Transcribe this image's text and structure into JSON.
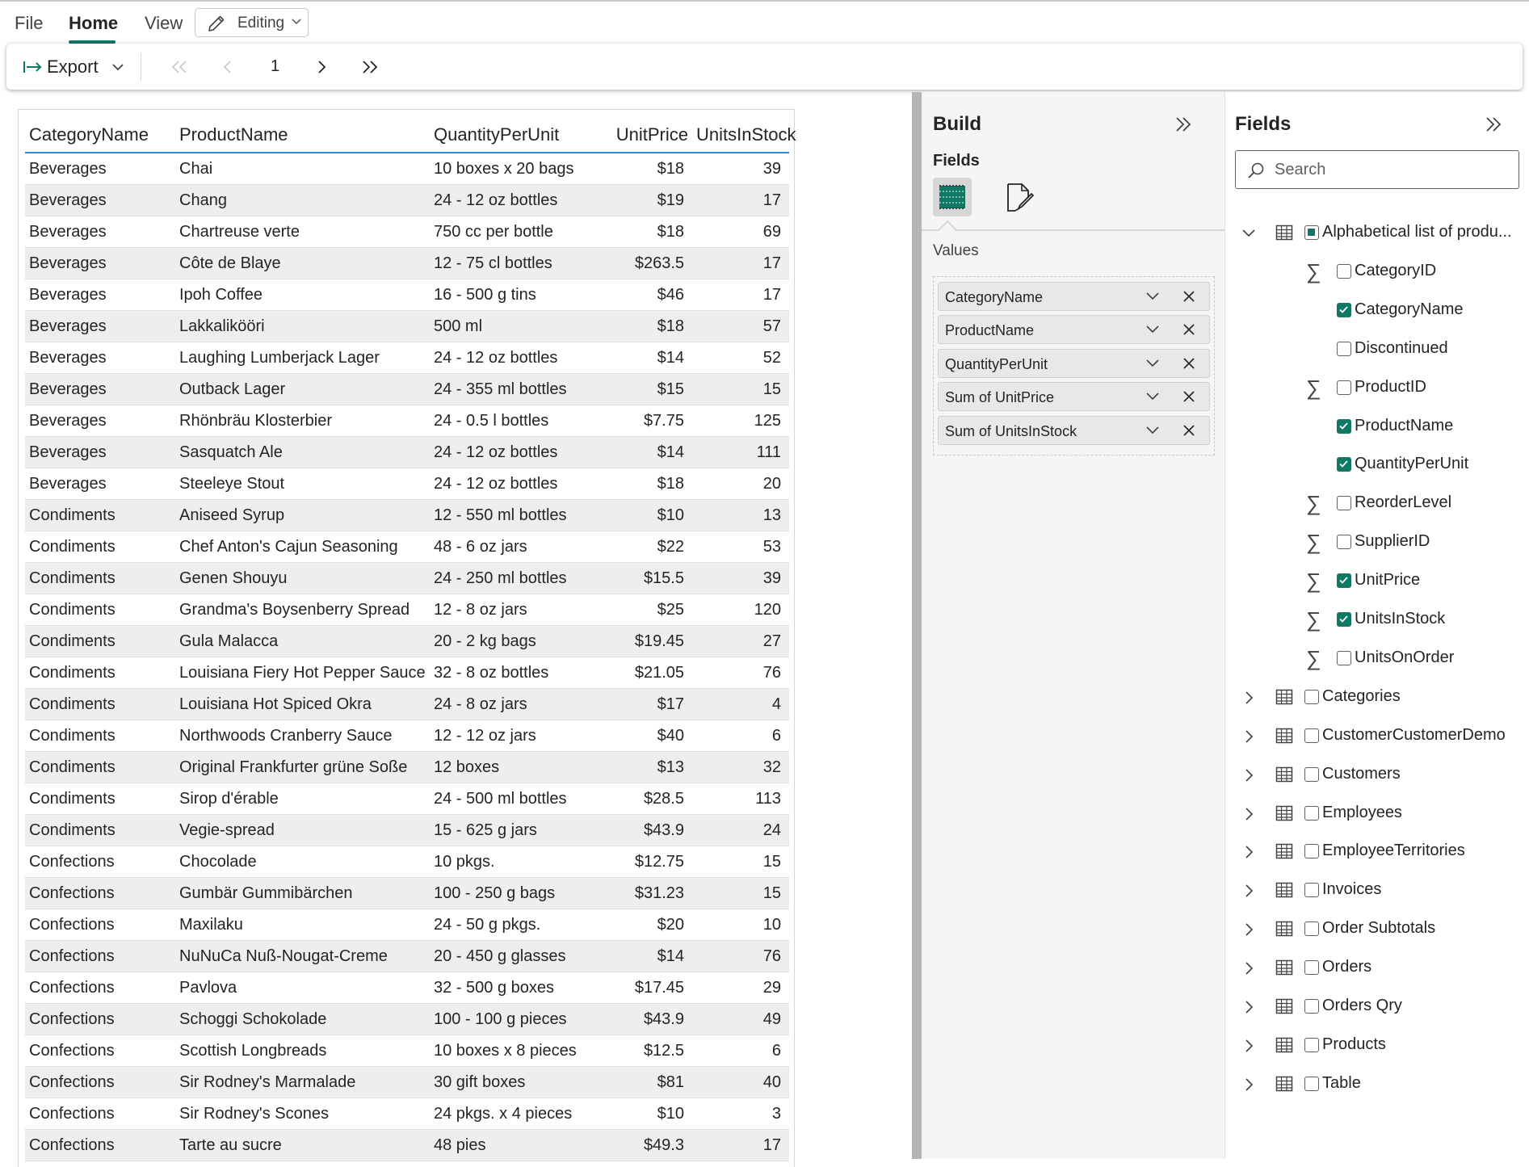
{
  "menu": {
    "file": "File",
    "home": "Home",
    "view": "View",
    "editing": "Editing"
  },
  "toolbar": {
    "export_label": "Export",
    "page_number": "1"
  },
  "table": {
    "headers": [
      "CategoryName",
      "ProductName",
      "QuantityPerUnit",
      "UnitPrice",
      "UnitsInStock"
    ],
    "rows": [
      [
        "Beverages",
        "Chai",
        "10 boxes x 20 bags",
        "$18",
        "39"
      ],
      [
        "Beverages",
        "Chang",
        "24 - 12 oz bottles",
        "$19",
        "17"
      ],
      [
        "Beverages",
        "Chartreuse verte",
        "750 cc per bottle",
        "$18",
        "69"
      ],
      [
        "Beverages",
        "Côte de Blaye",
        "12 - 75 cl bottles",
        "$263.5",
        "17"
      ],
      [
        "Beverages",
        "Ipoh Coffee",
        "16 - 500 g tins",
        "$46",
        "17"
      ],
      [
        "Beverages",
        "Lakkalikööri",
        "500 ml",
        "$18",
        "57"
      ],
      [
        "Beverages",
        "Laughing Lumberjack Lager",
        "24 - 12 oz bottles",
        "$14",
        "52"
      ],
      [
        "Beverages",
        "Outback Lager",
        "24 - 355 ml bottles",
        "$15",
        "15"
      ],
      [
        "Beverages",
        "Rhönbräu Klosterbier",
        "24 - 0.5 l bottles",
        "$7.75",
        "125"
      ],
      [
        "Beverages",
        "Sasquatch Ale",
        "24 - 12 oz bottles",
        "$14",
        "111"
      ],
      [
        "Beverages",
        "Steeleye Stout",
        "24 - 12 oz bottles",
        "$18",
        "20"
      ],
      [
        "Condiments",
        "Aniseed Syrup",
        "12 - 550 ml bottles",
        "$10",
        "13"
      ],
      [
        "Condiments",
        "Chef Anton's Cajun Seasoning",
        "48 - 6 oz jars",
        "$22",
        "53"
      ],
      [
        "Condiments",
        "Genen Shouyu",
        "24 - 250 ml bottles",
        "$15.5",
        "39"
      ],
      [
        "Condiments",
        "Grandma's Boysenberry Spread",
        "12 - 8 oz jars",
        "$25",
        "120"
      ],
      [
        "Condiments",
        "Gula Malacca",
        "20 - 2 kg bags",
        "$19.45",
        "27"
      ],
      [
        "Condiments",
        "Louisiana Fiery Hot Pepper Sauce",
        "32 - 8 oz bottles",
        "$21.05",
        "76"
      ],
      [
        "Condiments",
        "Louisiana Hot Spiced Okra",
        "24 - 8 oz jars",
        "$17",
        "4"
      ],
      [
        "Condiments",
        "Northwoods Cranberry Sauce",
        "12 - 12 oz jars",
        "$40",
        "6"
      ],
      [
        "Condiments",
        "Original Frankfurter grüne Soße",
        "12 boxes",
        "$13",
        "32"
      ],
      [
        "Condiments",
        "Sirop d'érable",
        "24 - 500 ml bottles",
        "$28.5",
        "113"
      ],
      [
        "Condiments",
        "Vegie-spread",
        "15 - 625 g jars",
        "$43.9",
        "24"
      ],
      [
        "Confections",
        "Chocolade",
        "10 pkgs.",
        "$12.75",
        "15"
      ],
      [
        "Confections",
        "Gumbär Gummibärchen",
        "100 - 250 g bags",
        "$31.23",
        "15"
      ],
      [
        "Confections",
        "Maxilaku",
        "24 - 50 g pkgs.",
        "$20",
        "10"
      ],
      [
        "Confections",
        "NuNuCa Nuß-Nougat-Creme",
        "20 - 450 g glasses",
        "$14",
        "76"
      ],
      [
        "Confections",
        "Pavlova",
        "32 - 500 g boxes",
        "$17.45",
        "29"
      ],
      [
        "Confections",
        "Schoggi Schokolade",
        "100 - 100 g pieces",
        "$43.9",
        "49"
      ],
      [
        "Confections",
        "Scottish Longbreads",
        "10 boxes x 8 pieces",
        "$12.5",
        "6"
      ],
      [
        "Confections",
        "Sir Rodney's Marmalade",
        "30 gift boxes",
        "$81",
        "40"
      ],
      [
        "Confections",
        "Sir Rodney's Scones",
        "24 pkgs. x 4 pieces",
        "$10",
        "3"
      ],
      [
        "Confections",
        "Tarte au sucre",
        "48 pies",
        "$49.3",
        "17"
      ]
    ]
  },
  "build": {
    "title": "Build",
    "fields_label": "Fields",
    "values_label": "Values",
    "value_pills": [
      "CategoryName",
      "ProductName",
      "QuantityPerUnit",
      "Sum of UnitPrice",
      "Sum of UnitsInStock"
    ]
  },
  "fields": {
    "title": "Fields",
    "search_placeholder": "Search",
    "tree": [
      {
        "label": "Alphabetical list of produ...",
        "kind": "table",
        "expanded": true,
        "state": "partial",
        "level": 0
      },
      {
        "label": "CategoryID",
        "kind": "sum",
        "state": "unchecked",
        "level": 1
      },
      {
        "label": "CategoryName",
        "kind": "field",
        "state": "checked",
        "level": 1
      },
      {
        "label": "Discontinued",
        "kind": "field",
        "state": "unchecked",
        "level": 1
      },
      {
        "label": "ProductID",
        "kind": "sum",
        "state": "unchecked",
        "level": 1
      },
      {
        "label": "ProductName",
        "kind": "field",
        "state": "checked",
        "level": 1
      },
      {
        "label": "QuantityPerUnit",
        "kind": "field",
        "state": "checked",
        "level": 1
      },
      {
        "label": "ReorderLevel",
        "kind": "sum",
        "state": "unchecked",
        "level": 1
      },
      {
        "label": "SupplierID",
        "kind": "sum",
        "state": "unchecked",
        "level": 1
      },
      {
        "label": "UnitPrice",
        "kind": "sum",
        "state": "checked",
        "level": 1
      },
      {
        "label": "UnitsInStock",
        "kind": "sum",
        "state": "checked",
        "level": 1
      },
      {
        "label": "UnitsOnOrder",
        "kind": "sum",
        "state": "unchecked",
        "level": 1
      },
      {
        "label": "Categories",
        "kind": "table",
        "expanded": false,
        "state": "unchecked",
        "level": 0
      },
      {
        "label": "CustomerCustomerDemo",
        "kind": "table",
        "expanded": false,
        "state": "unchecked",
        "level": 0
      },
      {
        "label": "Customers",
        "kind": "table",
        "expanded": false,
        "state": "unchecked",
        "level": 0
      },
      {
        "label": "Employees",
        "kind": "table",
        "expanded": false,
        "state": "unchecked",
        "level": 0
      },
      {
        "label": "EmployeeTerritories",
        "kind": "table",
        "expanded": false,
        "state": "unchecked",
        "level": 0
      },
      {
        "label": "Invoices",
        "kind": "table",
        "expanded": false,
        "state": "unchecked",
        "level": 0
      },
      {
        "label": "Order Subtotals",
        "kind": "table",
        "expanded": false,
        "state": "unchecked",
        "level": 0
      },
      {
        "label": "Orders",
        "kind": "table",
        "expanded": false,
        "state": "unchecked",
        "level": 0
      },
      {
        "label": "Orders Qry",
        "kind": "table",
        "expanded": false,
        "state": "unchecked",
        "level": 0
      },
      {
        "label": "Products",
        "kind": "table",
        "expanded": false,
        "state": "unchecked",
        "level": 0
      },
      {
        "label": "Table",
        "kind": "table",
        "expanded": false,
        "state": "unchecked",
        "level": 0
      }
    ]
  },
  "colors": {
    "accent": "#117865",
    "header_underline": "#3a87c7",
    "row_alt": "#eeeeee"
  }
}
